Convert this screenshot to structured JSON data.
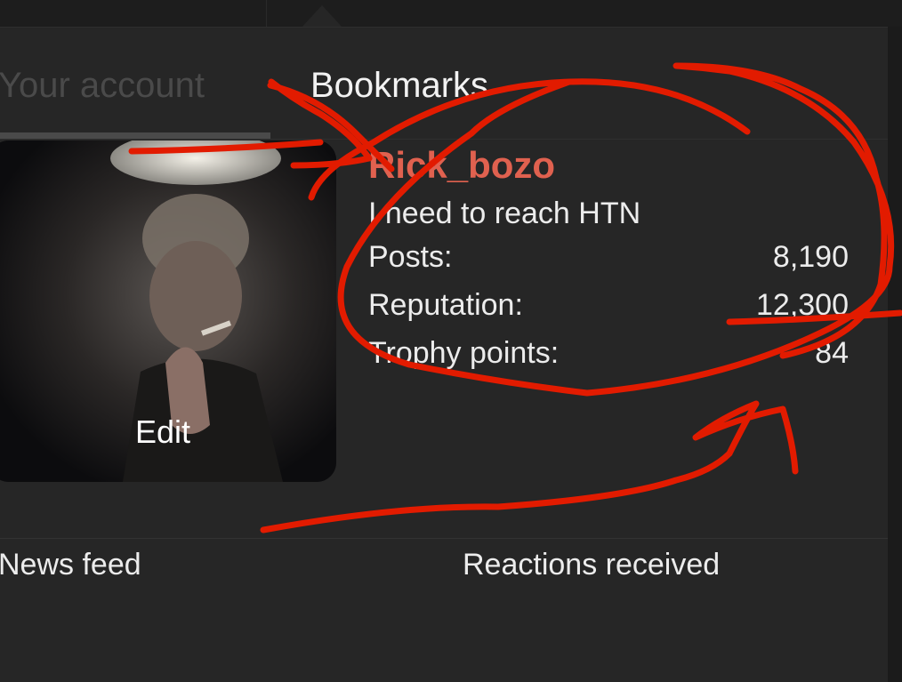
{
  "tabs": {
    "account_label": "Your account",
    "bookmarks_label": "Bookmarks"
  },
  "profile": {
    "username": "Rick_bozo",
    "user_title": "I need to reach HTN",
    "avatar_edit_label": "Edit",
    "stats": [
      {
        "label": "Posts:",
        "value": "8,190"
      },
      {
        "label": "Reputation:",
        "value": "12,300"
      },
      {
        "label": "Trophy points:",
        "value": "84"
      }
    ]
  },
  "links": {
    "news_feed": "News feed",
    "reactions_received": "Reactions received"
  },
  "colors": {
    "username": "#e0614f",
    "annotation_ink": "#e21b00",
    "panel_bg": "#262626"
  }
}
